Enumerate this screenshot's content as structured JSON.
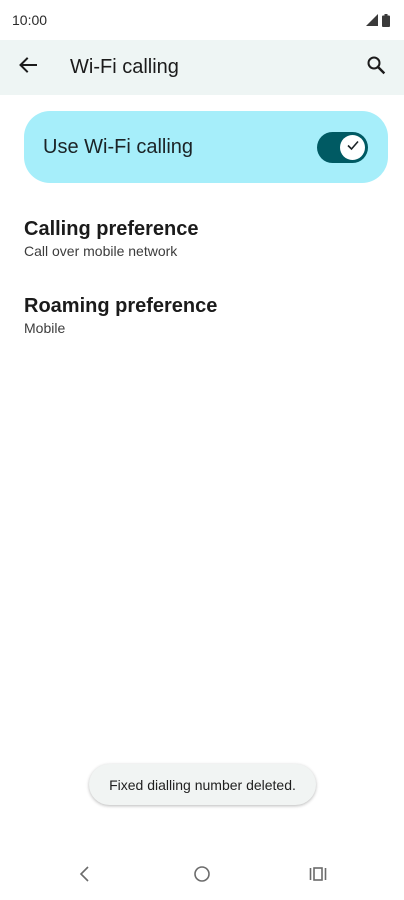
{
  "status_bar": {
    "time": "10:00",
    "icons": [
      "signal-icon",
      "battery-icon"
    ]
  },
  "app_bar": {
    "title": "Wi-Fi calling",
    "back_icon": "arrow-left-icon",
    "search_icon": "search-icon"
  },
  "main_switch": {
    "label": "Use Wi-Fi calling",
    "checked": true,
    "color_on": "#005a63",
    "card_color": "#a6eefa"
  },
  "preferences": [
    {
      "title": "Calling preference",
      "summary": "Call over mobile network"
    },
    {
      "title": "Roaming preference",
      "summary": "Mobile"
    }
  ],
  "toast": {
    "message": "Fixed dialling number deleted."
  },
  "nav_bar": {
    "icons": [
      "nav-back-icon",
      "nav-home-icon",
      "nav-recents-icon"
    ]
  }
}
